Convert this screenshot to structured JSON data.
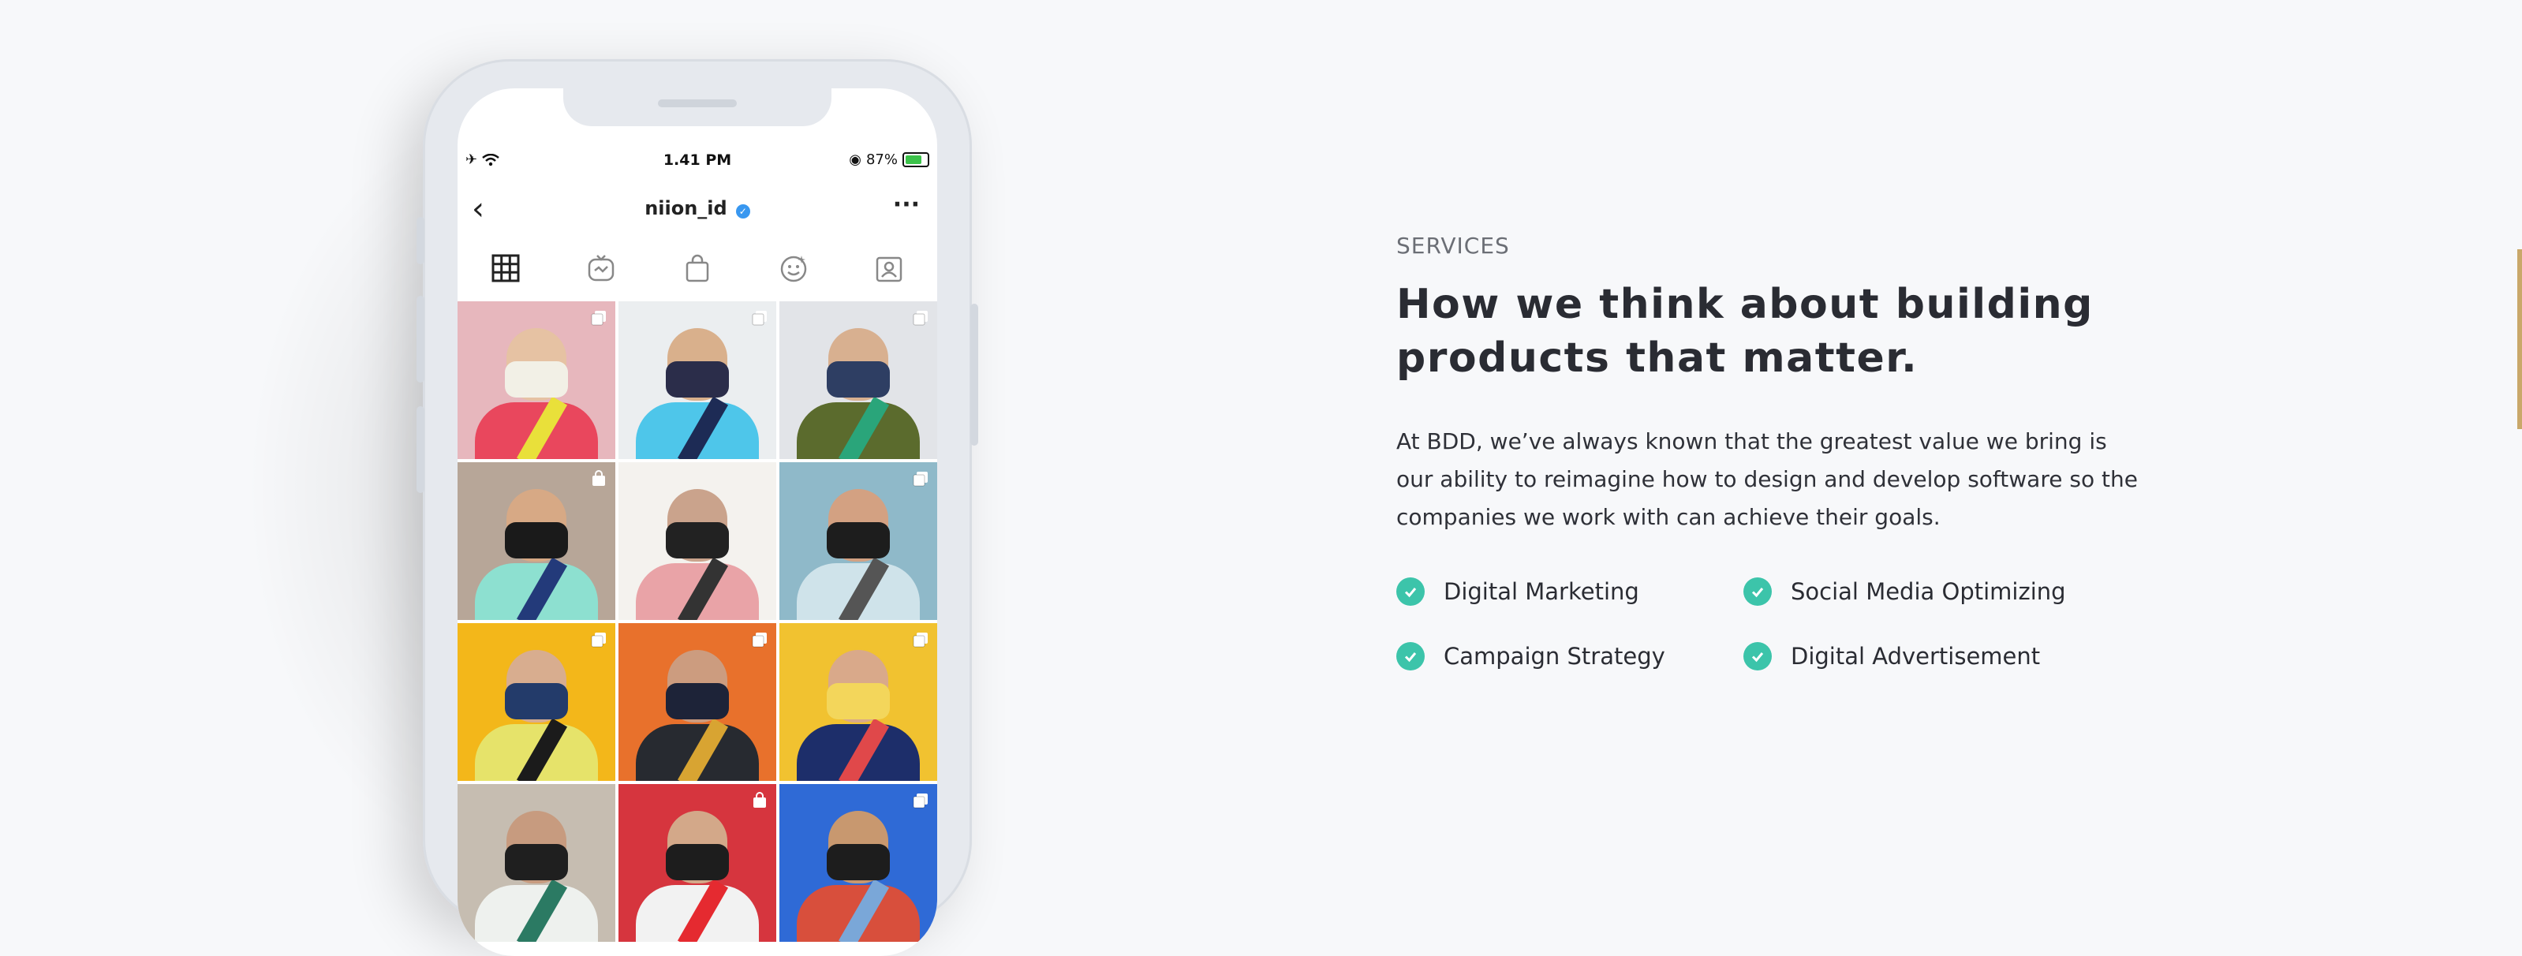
{
  "phone": {
    "status": {
      "time": "1.41 PM",
      "battery": "87%"
    },
    "profile": {
      "handle": "niion_id"
    },
    "tabs": [
      "grid-icon",
      "igtv-icon",
      "shop-icon",
      "effects-icon",
      "tagged-icon"
    ],
    "grid_posts": [
      {
        "bg": "#e7b7bd",
        "skin": "#e6c2a3",
        "mask": "#f2f0e6",
        "body": "#e9475d",
        "accent": "#e9e03a",
        "overlay": "multi"
      },
      {
        "bg": "#ebeef0",
        "skin": "#d9b08c",
        "mask": "#2b2d4a",
        "body": "#4ec6ea",
        "accent": "#1d2b55",
        "overlay": "multi"
      },
      {
        "bg": "#e2e4e8",
        "skin": "#d8b090",
        "mask": "#2e3e63",
        "body": "#5b6b2d",
        "accent": "#2aa57a",
        "overlay": "multi"
      },
      {
        "bg": "#b7a698",
        "skin": "#d7a985",
        "mask": "#1a1a1a",
        "body": "#8de0d0",
        "accent": "#233a7a",
        "overlay": "shop"
      },
      {
        "bg": "#f4f2ee",
        "skin": "#caa38c",
        "mask": "#222222",
        "body": "#e9a3a7",
        "accent": "#333333",
        "overlay": "none"
      },
      {
        "bg": "#8fb9c9",
        "skin": "#d3a182",
        "mask": "#1d1d1d",
        "body": "#cfe3ea",
        "accent": "#555555",
        "overlay": "multi"
      },
      {
        "bg": "#f3b71a",
        "skin": "#d8ad8f",
        "mask": "#233b6a",
        "body": "#e6e36a",
        "accent": "#1b1b1b",
        "overlay": "multi"
      },
      {
        "bg": "#e8712c",
        "skin": "#cc9c7f",
        "mask": "#1d2338",
        "body": "#272a30",
        "accent": "#d8a432",
        "overlay": "multi"
      },
      {
        "bg": "#f1c230",
        "skin": "#d9a98a",
        "mask": "#f3d65b",
        "body": "#1d2e6a",
        "accent": "#e0484a",
        "overlay": "multi"
      },
      {
        "bg": "#c6bdb1",
        "skin": "#c79b7f",
        "mask": "#1f1f1f",
        "body": "#eef1ee",
        "accent": "#2b7a63",
        "overlay": "none"
      },
      {
        "bg": "#d6353e",
        "skin": "#d3a889",
        "mask": "#1d1d1d",
        "body": "#f2f2f2",
        "accent": "#e52a30",
        "overlay": "shop"
      },
      {
        "bg": "#2f6ad6",
        "skin": "#c8986f",
        "mask": "#1d1d1d",
        "body": "#d84f3c",
        "accent": "#7aa7d8",
        "overlay": "multi"
      }
    ]
  },
  "content": {
    "label": "SERVICES",
    "headline": "How we think about building products that matter.",
    "body": "At BDD, we’ve always known that the greatest value we bring is our ability to reimagine how to design and develop software so the companies we work with can achieve their goals.",
    "features": [
      "Digital Marketing",
      "Social Media Optimizing",
      "Campaign Strategy",
      "Digital Advertisement"
    ],
    "check_color": "#3cc4aa"
  }
}
